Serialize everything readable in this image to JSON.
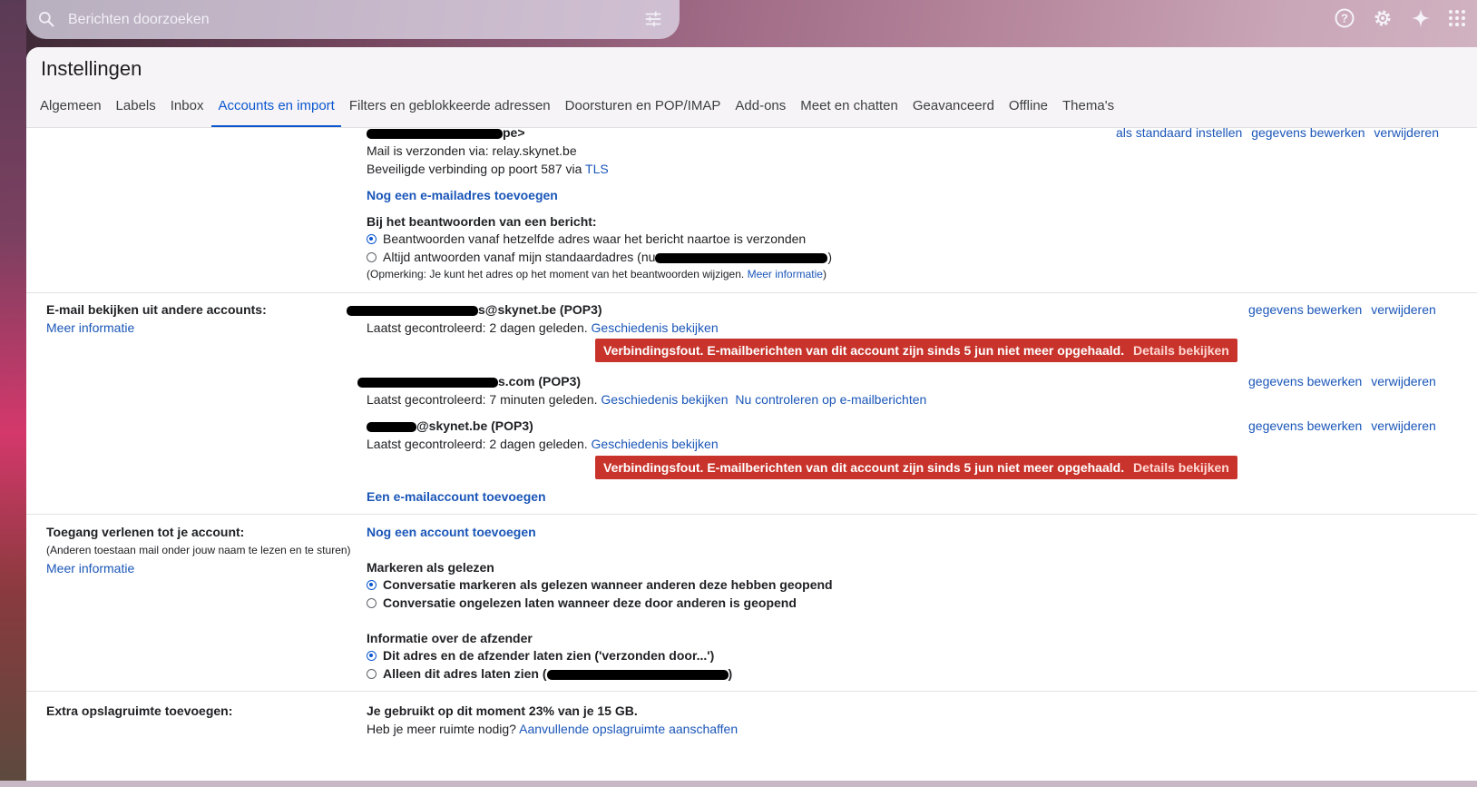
{
  "search": {
    "placeholder": "Berichten doorzoeken"
  },
  "header": {
    "title": "Instellingen"
  },
  "tabs": [
    {
      "label": "Algemeen"
    },
    {
      "label": "Labels"
    },
    {
      "label": "Inbox"
    },
    {
      "label": "Accounts en import",
      "active": true
    },
    {
      "label": "Filters en geblokkeerde adressen"
    },
    {
      "label": "Doorsturen en POP/IMAP"
    },
    {
      "label": "Add-ons"
    },
    {
      "label": "Meet en chatten"
    },
    {
      "label": "Geavanceerd"
    },
    {
      "label": "Offline"
    },
    {
      "label": "Thema's"
    }
  ],
  "send_as": {
    "partial_line": "pe>",
    "smtp_line": "Mail is verzonden via: relay.skynet.be",
    "secure_line": "Beveiligde verbinding op poort 587 via",
    "tls": "TLS",
    "actions": {
      "default": "als standaard instellen",
      "edit": "gegevens bewerken",
      "delete": "verwijderen"
    },
    "add_address": "Nog een e-mailadres toevoegen",
    "reply_heading": "Bij het beantwoorden van een bericht:",
    "reply_opt1": "Beantwoorden vanaf hetzelfde adres waar het bericht naartoe is verzonden",
    "reply_opt2": "Altijd antwoorden vanaf mijn standaardadres (nu",
    "reply_opt2_end": ")",
    "note": "(Opmerking: Je kunt het adres op het moment van het beantwoorden wijzigen.",
    "note_link": "Meer informatie",
    "note_end": ")"
  },
  "check_mail": {
    "label": "E-mail bekijken uit andere accounts:",
    "more_info": "Meer informatie",
    "accounts": [
      {
        "address_visible": "s@skynet.be (POP3)",
        "status": "Laatst gecontroleerd: 2 dagen geleden.",
        "history": "Geschiedenis bekijken",
        "error": "Verbindingsfout. E-mailberichten van dit account zijn sinds 5 jun niet meer opgehaald.",
        "error_link": "Details bekijken"
      },
      {
        "address_visible": "s.com (POP3)",
        "status": "Laatst gecontroleerd: 7 minuten geleden.",
        "history": "Geschiedenis bekijken",
        "check_now": "Nu controleren op e-mailberichten"
      },
      {
        "address_visible": "@skynet.be (POP3)",
        "status": "Laatst gecontroleerd: 2 dagen geleden.",
        "history": "Geschiedenis bekijken",
        "error": "Verbindingsfout. E-mailberichten van dit account zijn sinds 5 jun niet meer opgehaald.",
        "error_link": "Details bekijken"
      }
    ],
    "edit": "gegevens bewerken",
    "delete": "verwijderen",
    "add_account": "Een e-mailaccount toevoegen"
  },
  "grant_access": {
    "label": "Toegang verlenen tot je account:",
    "sublabel": "(Anderen toestaan mail onder jouw naam te lezen en te sturen)",
    "more_info": "Meer informatie",
    "add_account": "Nog een account toevoegen",
    "mark_heading": "Markeren als gelezen",
    "mark_opt1": "Conversatie markeren als gelezen wanneer anderen deze hebben geopend",
    "mark_opt2": "Conversatie ongelezen laten wanneer deze door anderen is geopend",
    "sender_heading": "Informatie over de afzender",
    "sender_opt1": "Dit adres en de afzender laten zien ('verzonden door...')",
    "sender_opt2": "Alleen dit adres laten zien (",
    "sender_opt2_end": ")"
  },
  "storage": {
    "label": "Extra opslagruimte toevoegen:",
    "usage": "Je gebruikt op dit moment 23% van je 15 GB.",
    "need_more": "Heb je meer ruimte nodig?",
    "buy_link": "Aanvullende opslagruimte aanschaffen"
  },
  "icons": [
    "search-icon",
    "tune-icon",
    "help-icon",
    "gear-icon",
    "sparkle-icon",
    "apps-icon"
  ]
}
